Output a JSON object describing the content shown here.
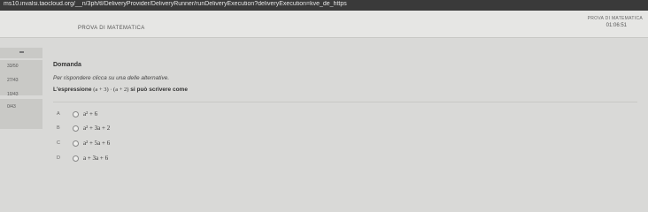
{
  "browser": {
    "url": "ms10.invalsi.taocloud.org/__n/3ph/tl/DeliveryProvider/DeliveryRunner/runDeliveryExecution?deliveryExecution=kve_de_https"
  },
  "header": {
    "test_title": "PROVA DI MATEMATICA",
    "right_title": "PROVA DI MATEMATICA",
    "timer": "01:06:51"
  },
  "sidebar": {
    "items": [
      "33/50",
      "27/43",
      "10/43",
      "0/43"
    ]
  },
  "question": {
    "heading": "Domanda",
    "instructions": "Per rispondere clicca su una delle alternative.",
    "prompt_before": "L'espressione",
    "prompt_math": "(a + 3) · (a + 2)",
    "prompt_after": "si può scrivere come"
  },
  "options": [
    {
      "letter": "A",
      "text": "a² + 6"
    },
    {
      "letter": "B",
      "text": "a² + 3a + 2"
    },
    {
      "letter": "C",
      "text": "a² + 5a + 6"
    },
    {
      "letter": "D",
      "text": "a + 3a + 6"
    }
  ]
}
